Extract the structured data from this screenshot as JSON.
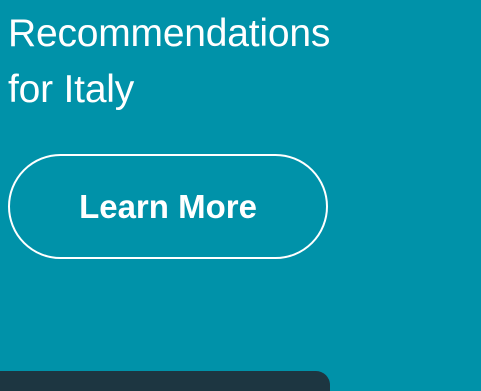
{
  "hero": {
    "title_line1": "Recommendations",
    "title_line2": "for Italy",
    "cta_label": "Learn More"
  },
  "colors": {
    "background": "#0092a9",
    "text": "#ffffff",
    "button_border": "#ffffff",
    "bottom_shape": "#1d3641"
  }
}
